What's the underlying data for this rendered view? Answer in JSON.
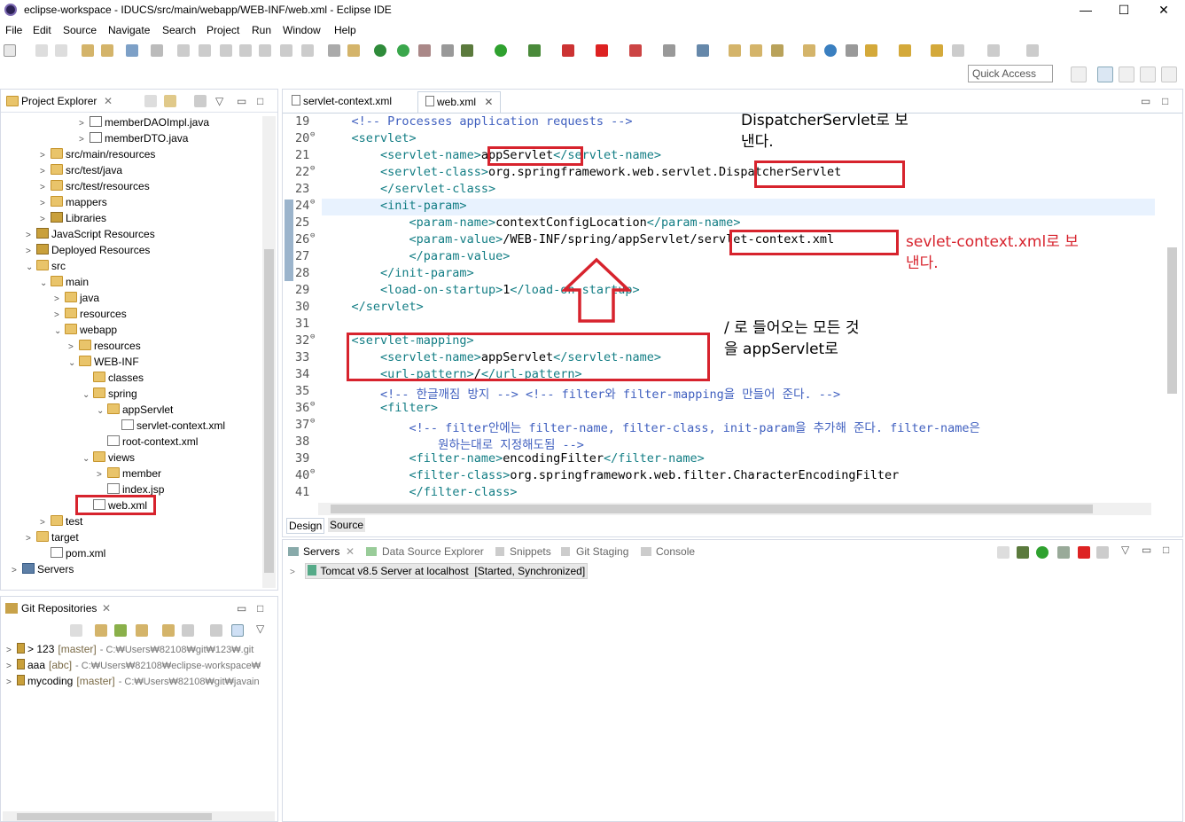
{
  "window": {
    "title": "eclipse-workspace - IDUCS/src/main/webapp/WEB-INF/web.xml - Eclipse IDE",
    "minimize": "—",
    "maximize": "☐",
    "close": "✕"
  },
  "menu": [
    "File",
    "Edit",
    "Source",
    "Navigate",
    "Search",
    "Project",
    "Run",
    "Window",
    "Help"
  ],
  "quick_access": "Quick Access",
  "project_explorer": {
    "title": "Project Explorer",
    "close": "✕",
    "items": [
      {
        "label": "memberDAOImpl.java",
        "arrow": ">",
        "icon": "java-file-icon"
      },
      {
        "label": "memberDTO.java",
        "arrow": ">",
        "icon": "java-file-icon"
      },
      {
        "label": "src/main/resources",
        "arrow": ">",
        "icon": "package-folder-icon"
      },
      {
        "label": "src/test/java",
        "arrow": ">",
        "icon": "package-folder-icon"
      },
      {
        "label": "src/test/resources",
        "arrow": ">",
        "icon": "package-folder-icon"
      },
      {
        "label": "mappers",
        "arrow": ">",
        "icon": "folder-icon"
      },
      {
        "label": "Libraries",
        "arrow": ">",
        "icon": "library-icon"
      },
      {
        "label": "JavaScript Resources",
        "arrow": ">",
        "icon": "library-icon"
      },
      {
        "label": "Deployed Resources",
        "arrow": ">",
        "icon": "library-icon"
      },
      {
        "label": "src",
        "arrow": "v",
        "icon": "folder-icon"
      },
      {
        "label": "main",
        "arrow": "v",
        "icon": "folder-icon"
      },
      {
        "label": "java",
        "arrow": ">",
        "icon": "folder-icon"
      },
      {
        "label": "resources",
        "arrow": ">",
        "icon": "folder-icon"
      },
      {
        "label": "webapp",
        "arrow": "v",
        "icon": "folder-icon"
      },
      {
        "label": "resources",
        "arrow": ">",
        "icon": "folder-icon"
      },
      {
        "label": "WEB-INF",
        "arrow": "v",
        "icon": "folder-icon"
      },
      {
        "label": "classes",
        "arrow": "",
        "icon": "folder-icon"
      },
      {
        "label": "spring",
        "arrow": "v",
        "icon": "folder-icon"
      },
      {
        "label": "appServlet",
        "arrow": "v",
        "icon": "folder-icon"
      },
      {
        "label": "servlet-context.xml",
        "arrow": "",
        "icon": "xml-file-icon"
      },
      {
        "label": "root-context.xml",
        "arrow": "",
        "icon": "xml-file-icon"
      },
      {
        "label": "views",
        "arrow": "v",
        "icon": "folder-icon"
      },
      {
        "label": "member",
        "arrow": ">",
        "icon": "folder-icon"
      },
      {
        "label": "index.jsp",
        "arrow": "",
        "icon": "jsp-file-icon"
      },
      {
        "label": "web.xml",
        "arrow": "",
        "icon": "xml-file-icon"
      },
      {
        "label": "test",
        "arrow": ">",
        "icon": "folder-icon"
      },
      {
        "label": "target",
        "arrow": ">",
        "icon": "folder-icon"
      },
      {
        "label": "pom.xml",
        "arrow": "",
        "icon": "xml-file-icon"
      },
      {
        "label": "Servers",
        "arrow": ">",
        "icon": "project-folder-icon"
      }
    ]
  },
  "git_repos": {
    "title": "Git Repositories",
    "close": "✕",
    "items": [
      {
        "name": "> 123",
        "branch": "[master]",
        "path": "- C:₩Users₩82108₩git₩123₩.git"
      },
      {
        "name": "aaa",
        "branch": "[abc]",
        "path": "- C:₩Users₩82108₩eclipse-workspace₩"
      },
      {
        "name": "mycoding",
        "branch": "[master]",
        "path": "- C:₩Users₩82108₩git₩javain"
      }
    ]
  },
  "editor": {
    "tabs": [
      {
        "label": "servlet-context.xml",
        "active": false
      },
      {
        "label": "web.xml",
        "active": true,
        "close": "✕"
      }
    ],
    "bottom_tabs": [
      "Design",
      "Source"
    ],
    "lines": [
      {
        "num": "19",
        "fold": "",
        "text": "    <!-- Processes application requests -->"
      },
      {
        "num": "20",
        "fold": "⊖",
        "text": "    <servlet>"
      },
      {
        "num": "21",
        "fold": "",
        "text": "        <servlet-name>appServlet</servlet-name>"
      },
      {
        "num": "22",
        "fold": "⊖",
        "text": "        <servlet-class>org.springframework.web.servlet.DispatcherServlet"
      },
      {
        "num": "23",
        "fold": "",
        "text": "        </servlet-class>"
      },
      {
        "num": "24",
        "fold": "⊖",
        "text": "        <init-param>"
      },
      {
        "num": "25",
        "fold": "",
        "text": "            <param-name>contextConfigLocation</param-name>"
      },
      {
        "num": "26",
        "fold": "⊖",
        "text": "            <param-value>/WEB-INF/spring/appServlet/servlet-context.xml"
      },
      {
        "num": "27",
        "fold": "",
        "text": "            </param-value>"
      },
      {
        "num": "28",
        "fold": "",
        "text": "        </init-param>"
      },
      {
        "num": "29",
        "fold": "",
        "text": "        <load-on-startup>1</load-on-startup>"
      },
      {
        "num": "30",
        "fold": "",
        "text": "    </servlet>"
      },
      {
        "num": "31",
        "fold": "",
        "text": ""
      },
      {
        "num": "32",
        "fold": "⊖",
        "text": "    <servlet-mapping>"
      },
      {
        "num": "33",
        "fold": "",
        "text": "        <servlet-name>appServlet</servlet-name>"
      },
      {
        "num": "34",
        "fold": "",
        "text": "        <url-pattern>/</url-pattern>"
      },
      {
        "num": "35",
        "fold": "",
        "text": "        <!-- 한글깨짐 방지 --> <!-- filter와 filter-mapping을 만들어 준다. -->"
      },
      {
        "num": "36",
        "fold": "⊖",
        "text": "        <filter>"
      },
      {
        "num": "37",
        "fold": "⊖",
        "text": "            <!-- filter안에는 filter-name, filter-class, init-param을 추가해 준다. filter-name은"
      },
      {
        "num": "38",
        "fold": "",
        "text": "                원하는대로 지정해도됨 -->"
      },
      {
        "num": "39",
        "fold": "",
        "text": "            <filter-name>encodingFilter</filter-name>"
      },
      {
        "num": "40",
        "fold": "⊖",
        "text": "            <filter-class>org.springframework.web.filter.CharacterEncodingFilter"
      },
      {
        "num": "41",
        "fold": "",
        "text": "            </filter-class>"
      }
    ]
  },
  "annotations": {
    "dispatcher": [
      "DispatcherServlet로 보",
      "낸다."
    ],
    "context": [
      "sevlet-context.xml로 보",
      "낸다."
    ],
    "mapping": [
      "/ 로 들어오는 모든 것",
      "을 appServlet로"
    ]
  },
  "servers_view": {
    "tabs": [
      "Servers",
      "Data Source Explorer",
      "Snippets",
      "Git Staging",
      "Console"
    ],
    "server": "Tomcat v8.5 Server at localhost  [Started, Synchronized]"
  },
  "colors": {
    "highlight_red": "#d7232d",
    "annotation_red": "#d7232d",
    "tag_teal": "#127d84",
    "comment_blue": "#3f5fbf"
  }
}
